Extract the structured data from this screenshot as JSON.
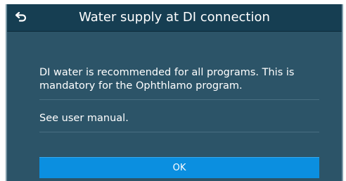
{
  "dialog": {
    "title": "Water supply at DI connection",
    "back_icon": "back-arrow-icon",
    "messages": [
      "DI water is recommended for all programs. This is mandatory for the Ophthlamo program.",
      "See user manual."
    ],
    "ok_label": "OK"
  },
  "colors": {
    "panel_background": "#2c5468",
    "titlebar_background": "#163e52",
    "button_background": "#0b8fe0",
    "text": "#ffffff"
  }
}
